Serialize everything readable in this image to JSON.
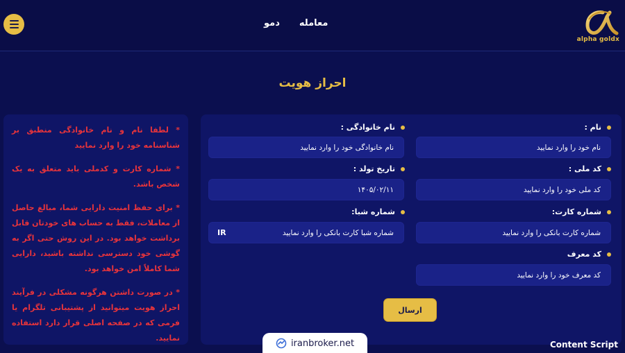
{
  "header": {
    "nav": [
      "معامله",
      "دمو"
    ],
    "logo_text": "alpha goldx"
  },
  "page_title": "احراز هویت",
  "form": {
    "first_name": {
      "label": "نام :",
      "placeholder": "نام خود را وارد نمایید"
    },
    "last_name": {
      "label": "نام خانوادگی :",
      "placeholder": "نام خانوادگی  خود را وارد نمایید"
    },
    "national_code": {
      "label": "کد ملی :",
      "placeholder": "کد ملی خود را وارد نمایید"
    },
    "birth_date": {
      "label": "تاریخ تولد :",
      "value": "۱۴۰۵/۰۲/۱۱"
    },
    "card_number": {
      "label": "شماره کارت:",
      "placeholder": "شماره کارت بانکی را وارد نمایید"
    },
    "sheba": {
      "label": "شماره شبا:",
      "placeholder": "شماره شبا کارت بانکی را وارد نمایید",
      "suffix": "IR"
    },
    "referral": {
      "label": "کد معرف",
      "placeholder": "کد معرف خود را وارد نمایید"
    },
    "submit_label": "ارسال"
  },
  "notes": [
    "* لطفا نام و نام خانوادگی منطبق بر شناسنامه خود را وارد نمایید",
    "* شماره کارت و کدملی باید متعلق به یک شخص باشد.",
    "* برای حفظ امنیت دارایی شما، مبالغ حاصل از معاملات، فقط به حساب های خودتان قابل برداشت خواهد بود. در این روش حتی اگر به گوشی خود دسترسی نداشته باشید، دارایی شما کاملاً امن خواهد بود.",
    "* در صورت داشتن هرگونه مشکلی در فرآیند احراز هویت میتوانید از پشتیبانی تلگرام یا فرمی که در صفحه اصلی قرار دارد استفاده نمایید."
  ],
  "watermark": "iranbroker.net",
  "footer_label": "Content Script",
  "colors": {
    "background": "#0b0f4f",
    "panel": "#0f1566",
    "gold": "#e6bd45",
    "note_red": "#e8343b"
  }
}
